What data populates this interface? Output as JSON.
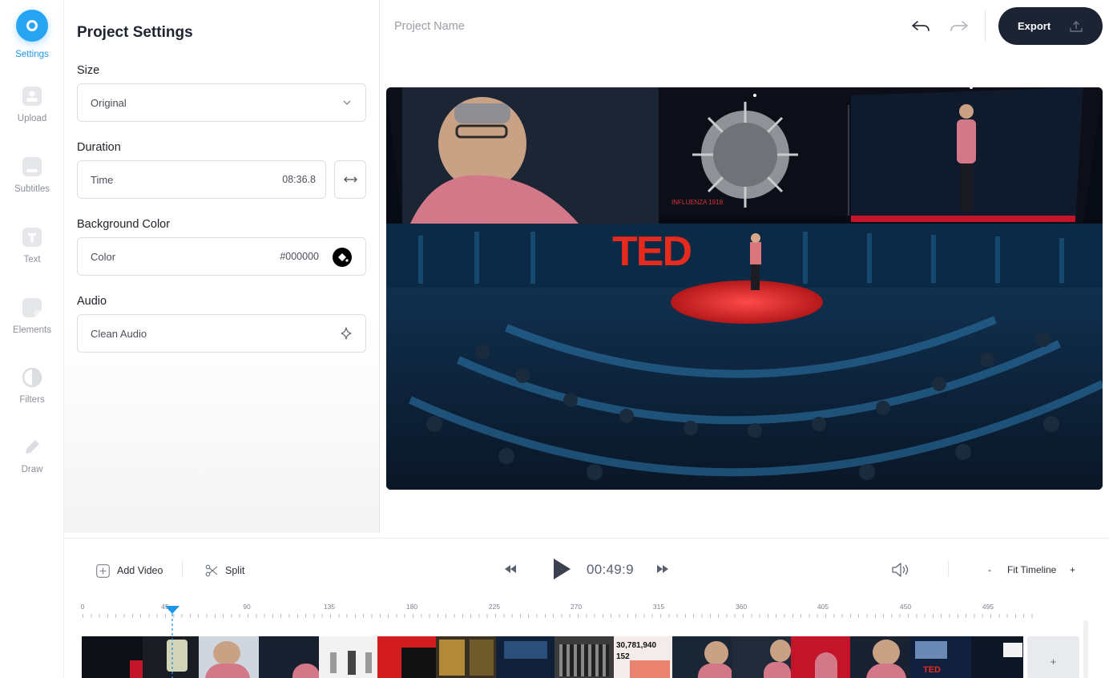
{
  "sidebar": {
    "items": [
      {
        "label": "Settings",
        "icon": "settings-icon",
        "active": true
      },
      {
        "label": "Upload",
        "icon": "upload-icon"
      },
      {
        "label": "Subtitles",
        "icon": "subtitles-icon"
      },
      {
        "label": "Text",
        "icon": "text-icon"
      },
      {
        "label": "Elements",
        "icon": "elements-icon"
      },
      {
        "label": "Filters",
        "icon": "filters-icon"
      },
      {
        "label": "Draw",
        "icon": "draw-icon"
      }
    ]
  },
  "settings": {
    "title": "Project Settings",
    "size": {
      "label": "Size",
      "value": "Original"
    },
    "duration": {
      "label": "Duration",
      "field_label": "Time",
      "value": "08:36.8"
    },
    "background": {
      "label": "Background Color",
      "field_label": "Color",
      "value": "#000000"
    },
    "audio": {
      "label": "Audio",
      "field_label": "Clean Audio"
    }
  },
  "header": {
    "project_name": "Project Name",
    "export_label": "Export"
  },
  "preview": {
    "stage_logo": "TED",
    "screen_caption": "INFLUENZA 1918"
  },
  "timeline": {
    "add_video_label": "Add Video",
    "split_label": "Split",
    "timecode": "00:49:9",
    "zoom_out": "-",
    "fit_label": "Fit Timeline",
    "zoom_in": "+",
    "ruler": [
      "0",
      "45",
      "90",
      "135",
      "180",
      "225",
      "270",
      "315",
      "360",
      "405",
      "450",
      "495"
    ],
    "add_clip": "+",
    "clip_text": {
      "stat": "30,781,940",
      "stat2": "152",
      "ted": "TED"
    }
  },
  "colors": {
    "accent": "#27a4f2",
    "export_bg": "#1c2333",
    "ted_red": "#e62b1e"
  }
}
